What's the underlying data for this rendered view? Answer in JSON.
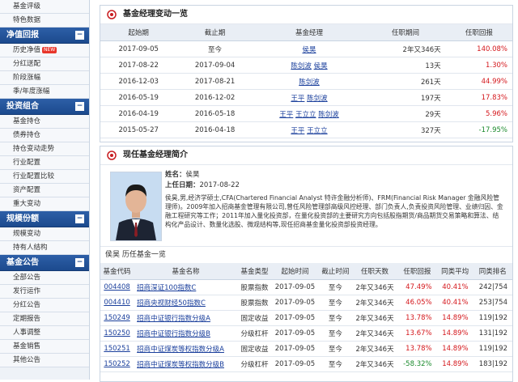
{
  "sidebar": {
    "top_items": [
      "基金评级",
      "特色数据"
    ],
    "sections": [
      {
        "title": "净值回报",
        "toggle": "⊟",
        "items": [
          {
            "label": "历史净值",
            "badge": "NEW"
          },
          {
            "label": "分红送配"
          },
          {
            "label": "阶段涨幅"
          },
          {
            "label": "季/年度涨幅"
          }
        ]
      },
      {
        "title": "投资组合",
        "toggle": "⊟",
        "items": [
          {
            "label": "基金持仓"
          },
          {
            "label": "债券持仓"
          },
          {
            "label": "持仓变动走势"
          },
          {
            "label": "行业配置"
          },
          {
            "label": "行业配置比较"
          },
          {
            "label": "资产配置"
          },
          {
            "label": "重大变动"
          }
        ]
      },
      {
        "title": "规模份额",
        "toggle": "⊟",
        "items": [
          {
            "label": "规模变动"
          },
          {
            "label": "持有人结构"
          }
        ]
      },
      {
        "title": "基金公告",
        "toggle": "⊟",
        "items": [
          {
            "label": "全部公告"
          },
          {
            "label": "发行运作"
          },
          {
            "label": "分红公告"
          },
          {
            "label": "定期报告"
          },
          {
            "label": "人事调整"
          },
          {
            "label": "基金销售"
          },
          {
            "label": "其他公告"
          }
        ]
      }
    ]
  },
  "manager_changes": {
    "title": "基金经理变动一览",
    "columns": [
      "起始期",
      "截止期",
      "基金经理",
      "任职期间",
      "任职回报"
    ],
    "rows": [
      {
        "start": "2017-09-05",
        "end": "至今",
        "managers": [
          "侯昊"
        ],
        "period": "2年又346天",
        "return": "140.08%",
        "sign": "pos"
      },
      {
        "start": "2017-08-22",
        "end": "2017-09-04",
        "managers": [
          "陈剑波",
          "侯昊"
        ],
        "period": "13天",
        "return": "1.30%",
        "sign": "pos"
      },
      {
        "start": "2016-12-03",
        "end": "2017-08-21",
        "managers": [
          "陈剑波"
        ],
        "period": "261天",
        "return": "44.99%",
        "sign": "pos"
      },
      {
        "start": "2016-05-19",
        "end": "2016-12-02",
        "managers": [
          "王平",
          "陈剑波"
        ],
        "period": "197天",
        "return": "17.83%",
        "sign": "pos"
      },
      {
        "start": "2016-04-19",
        "end": "2016-05-18",
        "managers": [
          "王平",
          "王立立",
          "陈剑波"
        ],
        "period": "29天",
        "return": "5.96%",
        "sign": "pos"
      },
      {
        "start": "2015-05-27",
        "end": "2016-04-18",
        "managers": [
          "王平",
          "王立立"
        ],
        "period": "327天",
        "return": "-17.95%",
        "sign": "neg"
      }
    ]
  },
  "current_manager": {
    "title": "现任基金经理简介",
    "name_label": "姓名：",
    "name": "侯昊",
    "date_label": "上任日期：",
    "date": "2017-08-22",
    "bio": "侯昊,男,经济学硕士,CFA(Chartered Financial Analyst 特许金融分析师)、FRM(Financial Risk Manager 金融风险管理师)。2009年加入招商基金管理有限公司,曾任风险管理部高级风控经理、部门负责人,负责投资风险管理、业绩归因、金融工程研究等工作；2011年加入量化投资部，在量化投资部的主要研究方向包括股指期货/商品期货交易策略和算法、结构化产品设计、数量化选股、微观结构等,现任招商基金量化投资部投资经理。",
    "history_title": "侯昊 历任基金一览",
    "history_columns": [
      "基金代码",
      "基金名称",
      "基金类型",
      "起始时间",
      "截止时间",
      "任职天数",
      "任职回报",
      "同类平均",
      "同类排名"
    ],
    "history_rows": [
      {
        "code": "004408",
        "name": "招商深证100指数C",
        "type": "股票指数",
        "start": "2017-09-05",
        "end": "至今",
        "days": "2年又346天",
        "ret": "47.49%",
        "avg": "40.41%",
        "rank": "242|754",
        "ret_sign": "pos",
        "avg_sign": "pos"
      },
      {
        "code": "004410",
        "name": "招商央视财经50指数C",
        "type": "股票指数",
        "start": "2017-09-05",
        "end": "至今",
        "days": "2年又346天",
        "ret": "46.05%",
        "avg": "40.41%",
        "rank": "253|754",
        "ret_sign": "pos",
        "avg_sign": "pos"
      },
      {
        "code": "150249",
        "name": "招商中证银行指数分级A",
        "type": "固定收益",
        "start": "2017-09-05",
        "end": "至今",
        "days": "2年又346天",
        "ret": "13.78%",
        "avg": "14.89%",
        "rank": "119|192",
        "ret_sign": "pos",
        "avg_sign": "pos"
      },
      {
        "code": "150250",
        "name": "招商中证银行指数分级B",
        "type": "分级杠杆",
        "start": "2017-09-05",
        "end": "至今",
        "days": "2年又346天",
        "ret": "13.67%",
        "avg": "14.89%",
        "rank": "131|192",
        "ret_sign": "pos",
        "avg_sign": "pos"
      },
      {
        "code": "150251",
        "name": "招商中证煤炭等权指数分级A",
        "type": "固定收益",
        "start": "2017-09-05",
        "end": "至今",
        "days": "2年又346天",
        "ret": "13.78%",
        "avg": "14.89%",
        "rank": "119|192",
        "ret_sign": "pos",
        "avg_sign": "pos"
      },
      {
        "code": "150252",
        "name": "招商中证煤炭等权指数分级B",
        "type": "分级杠杆",
        "start": "2017-09-05",
        "end": "至今",
        "days": "2年又346天",
        "ret": "-58.32%",
        "avg": "14.89%",
        "rank": "183|192",
        "ret_sign": "neg",
        "avg_sign": "pos"
      }
    ]
  },
  "colors": {
    "positive": "#d4161b",
    "negative": "#1a8a2c",
    "nav_header": "#1c4a8e"
  }
}
